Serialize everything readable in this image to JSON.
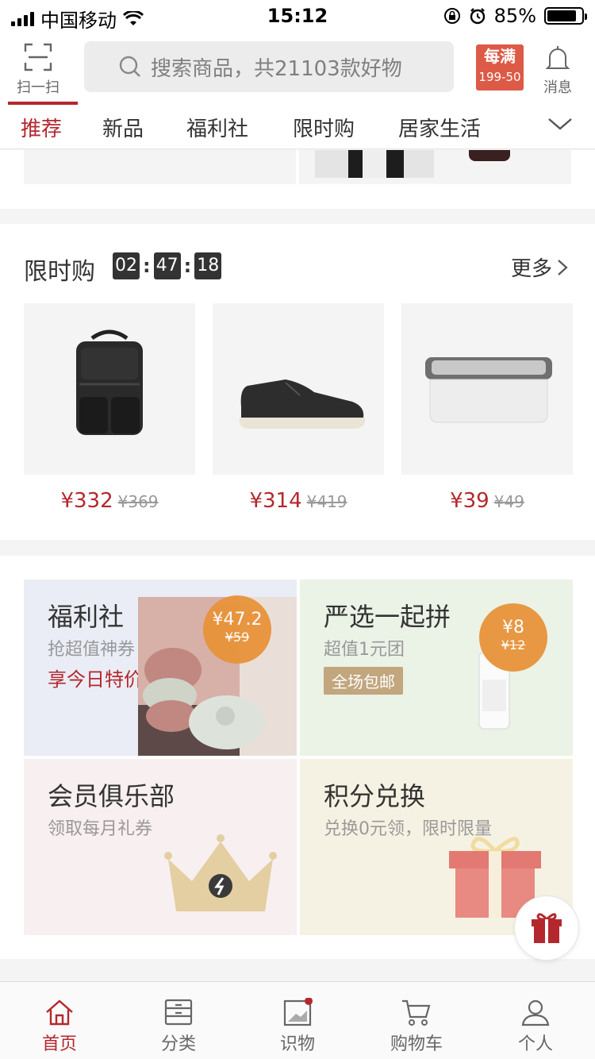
{
  "status": {
    "carrier": "中国移动",
    "time": "15:12",
    "battery": "85%",
    "battery_level": 0.85
  },
  "header": {
    "scan_label": "扫一扫",
    "search_placeholder": "搜索商品，共21103款好物",
    "promo_line1": "每满",
    "promo_line2": "199-50",
    "message_label": "消息"
  },
  "tabs": [
    "推荐",
    "新品",
    "福利社",
    "限时购",
    "居家生活"
  ],
  "flash": {
    "title": "限时购",
    "timer": [
      "02",
      "47",
      "18"
    ],
    "more": "更多",
    "products": [
      {
        "icon": "backpack-image",
        "price": "¥332",
        "original": "¥369"
      },
      {
        "icon": "shoe-image",
        "price": "¥314",
        "original": "¥419"
      },
      {
        "icon": "storage-box-image",
        "price": "¥39",
        "original": "¥49"
      }
    ]
  },
  "features": {
    "welfare": {
      "title": "福利社",
      "subtitle": "抢超值神券",
      "highlight": "享今日特价",
      "price": "¥47.2",
      "original": "¥59"
    },
    "group": {
      "title": "严选一起拼",
      "subtitle": "超值1元团",
      "tag": "全场包邮",
      "price": "¥8",
      "original": "¥12"
    },
    "club": {
      "title": "会员俱乐部",
      "subtitle": "领取每月礼券"
    },
    "points": {
      "title": "积分兑换",
      "subtitle": "兑换0元领，限时限量"
    }
  },
  "tabbar": [
    "首页",
    "分类",
    "识物",
    "购物车",
    "个人"
  ],
  "colors": {
    "accent": "#b4282d",
    "promo": "#dd5a46",
    "badge": "#e8933a"
  }
}
